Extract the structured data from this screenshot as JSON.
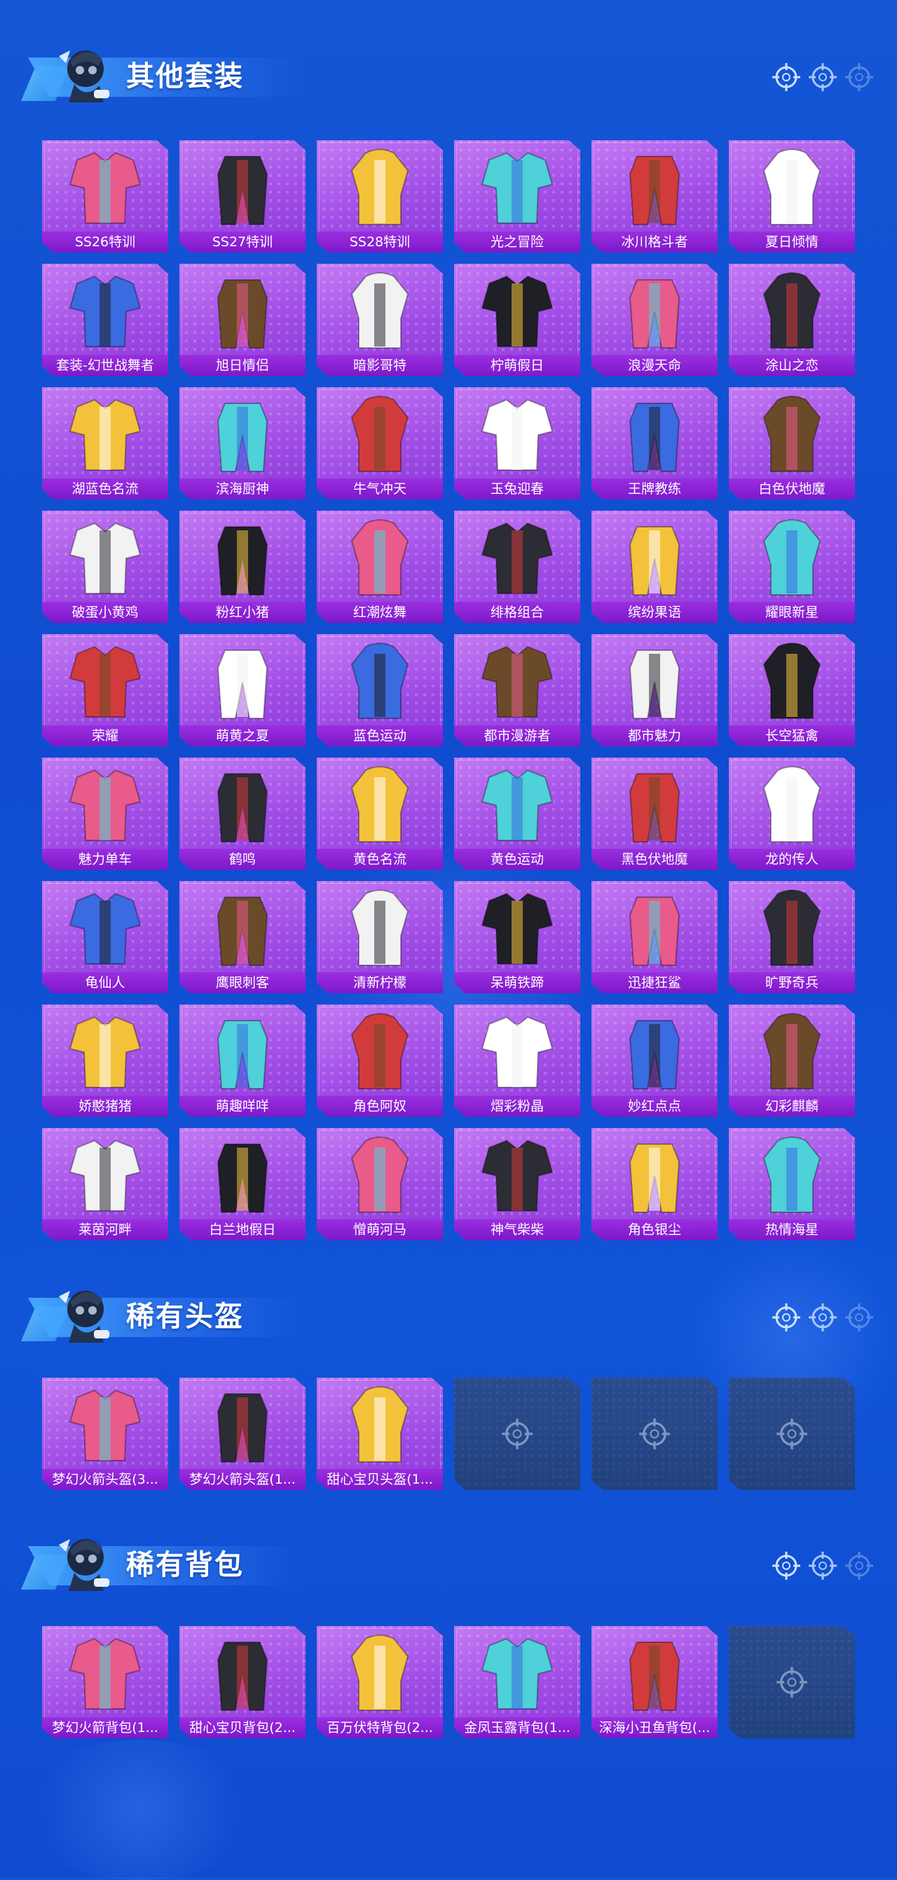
{
  "sections": {
    "outfits": {
      "title": "其他套装",
      "items": [
        "SS26特训",
        "SS27特训",
        "SS28特训",
        "光之冒险",
        "冰川格斗者",
        "夏日倾情",
        "套装-幻世战舞者",
        "旭日情侣",
        "暗影哥特",
        "柠萌假日",
        "浪漫天命",
        "涂山之恋",
        "湖蓝色名流",
        "滨海厨神",
        "牛气冲天",
        "玉兔迎春",
        "王牌教练",
        "白色伏地魔",
        "破蛋小黄鸡",
        "粉红小猪",
        "红潮炫舞",
        "绯格组合",
        "缤纷果语",
        "耀眼新星",
        "荣耀",
        "萌黄之夏",
        "蓝色运动",
        "都市漫游者",
        "都市魅力",
        "长空猛禽",
        "魅力单车",
        "鹤鸣",
        "黄色名流",
        "黄色运动",
        "黑色伏地魔",
        "龙的传人",
        "龟仙人",
        "鹰眼刺客",
        "清新柠檬",
        "呆萌铁蹄",
        "迅捷狂鲨",
        "旷野奇兵",
        "娇憨猪猪",
        "萌趣咩咩",
        "角色阿奴",
        "熠彩粉晶",
        "妙红点点",
        "幻彩麒麟",
        "莱茵河畔",
        "白兰地假日",
        "憎萌河马",
        "神气柴柴",
        "角色银尘",
        "热情海星"
      ]
    },
    "helmets": {
      "title": "稀有头盔",
      "items": [
        "梦幻火箭头盔(3...",
        "梦幻火箭头盔(1...",
        "甜心宝贝头盔(1..."
      ],
      "empty_slots": 3
    },
    "backpacks": {
      "title": "稀有背包",
      "items": [
        "梦幻火箭背包(1...",
        "甜心宝贝背包(2...",
        "百万伏特背包(2...",
        "金凤玉露背包(1...",
        "深海小丑鱼背包(..."
      ],
      "empty_slots": 1
    }
  },
  "icons": {
    "header_avatar": "avatar-icon",
    "reticle": "crosshair-icon",
    "empty_slot": "crosshair-icon"
  },
  "colors": {
    "background": "#1456d6",
    "tile": "#a14ee6",
    "tile_label": "#7d19c9",
    "empty_tile": "#24457f",
    "accent": "#6fd0ff"
  }
}
